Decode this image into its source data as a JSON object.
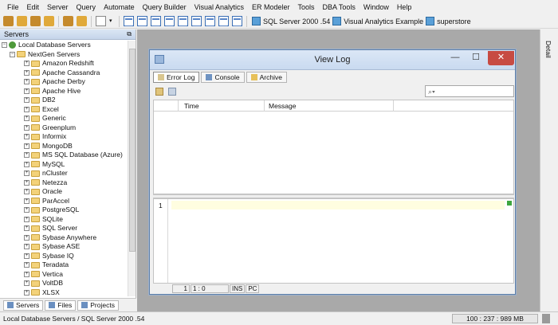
{
  "menu": [
    "File",
    "Edit",
    "Server",
    "Query",
    "Automate",
    "Query Builder",
    "Visual Analytics",
    "ER Modeler",
    "Tools",
    "DBA Tools",
    "Window",
    "Help"
  ],
  "toolbar": {
    "connections": [
      "SQL Server 2000 .54",
      "Visual Analytics Example",
      "superstore"
    ]
  },
  "left_panel": {
    "title": "Servers",
    "root": "Local Database Servers",
    "group": "NextGen Servers",
    "items": [
      "Amazon Redshift",
      "Apache Cassandra",
      "Apache Derby",
      "Apache Hive",
      "DB2",
      "Excel",
      "Generic",
      "Greenplum",
      "Informix",
      "MongoDB",
      "MS SQL Database (Azure)",
      "MySQL",
      "nCluster",
      "Netezza",
      "Oracle",
      "ParAccel",
      "PostgreSQL",
      "SQLite",
      "SQL Server",
      "Sybase Anywhere",
      "Sybase ASE",
      "Sybase IQ",
      "Teradata",
      "Vertica",
      "VoltDB",
      "XLSX"
    ],
    "tabs": [
      "Servers",
      "Files",
      "Projects"
    ]
  },
  "right_strip": {
    "label": "Detail"
  },
  "dialog": {
    "title": "View Log",
    "min_label": "—",
    "max_label": "☐",
    "close_label": "✕",
    "tabs": [
      "Error Log",
      "Console",
      "Archive"
    ],
    "active_tab": "Error Log",
    "search_placeholder": "",
    "columns": [
      "Time",
      "Message"
    ],
    "editor": {
      "line_number": "1"
    },
    "status": [
      "1",
      "1 : 0",
      "INS",
      "PC"
    ]
  },
  "statusbar": {
    "path": "Local Database Servers / SQL Server 2000 .54",
    "memory": "100 : 237 : 989 MB"
  },
  "colors": {
    "close_button": "#c74b43",
    "workspace": "#a9a9a9",
    "title_bar": "#c9daf0"
  }
}
